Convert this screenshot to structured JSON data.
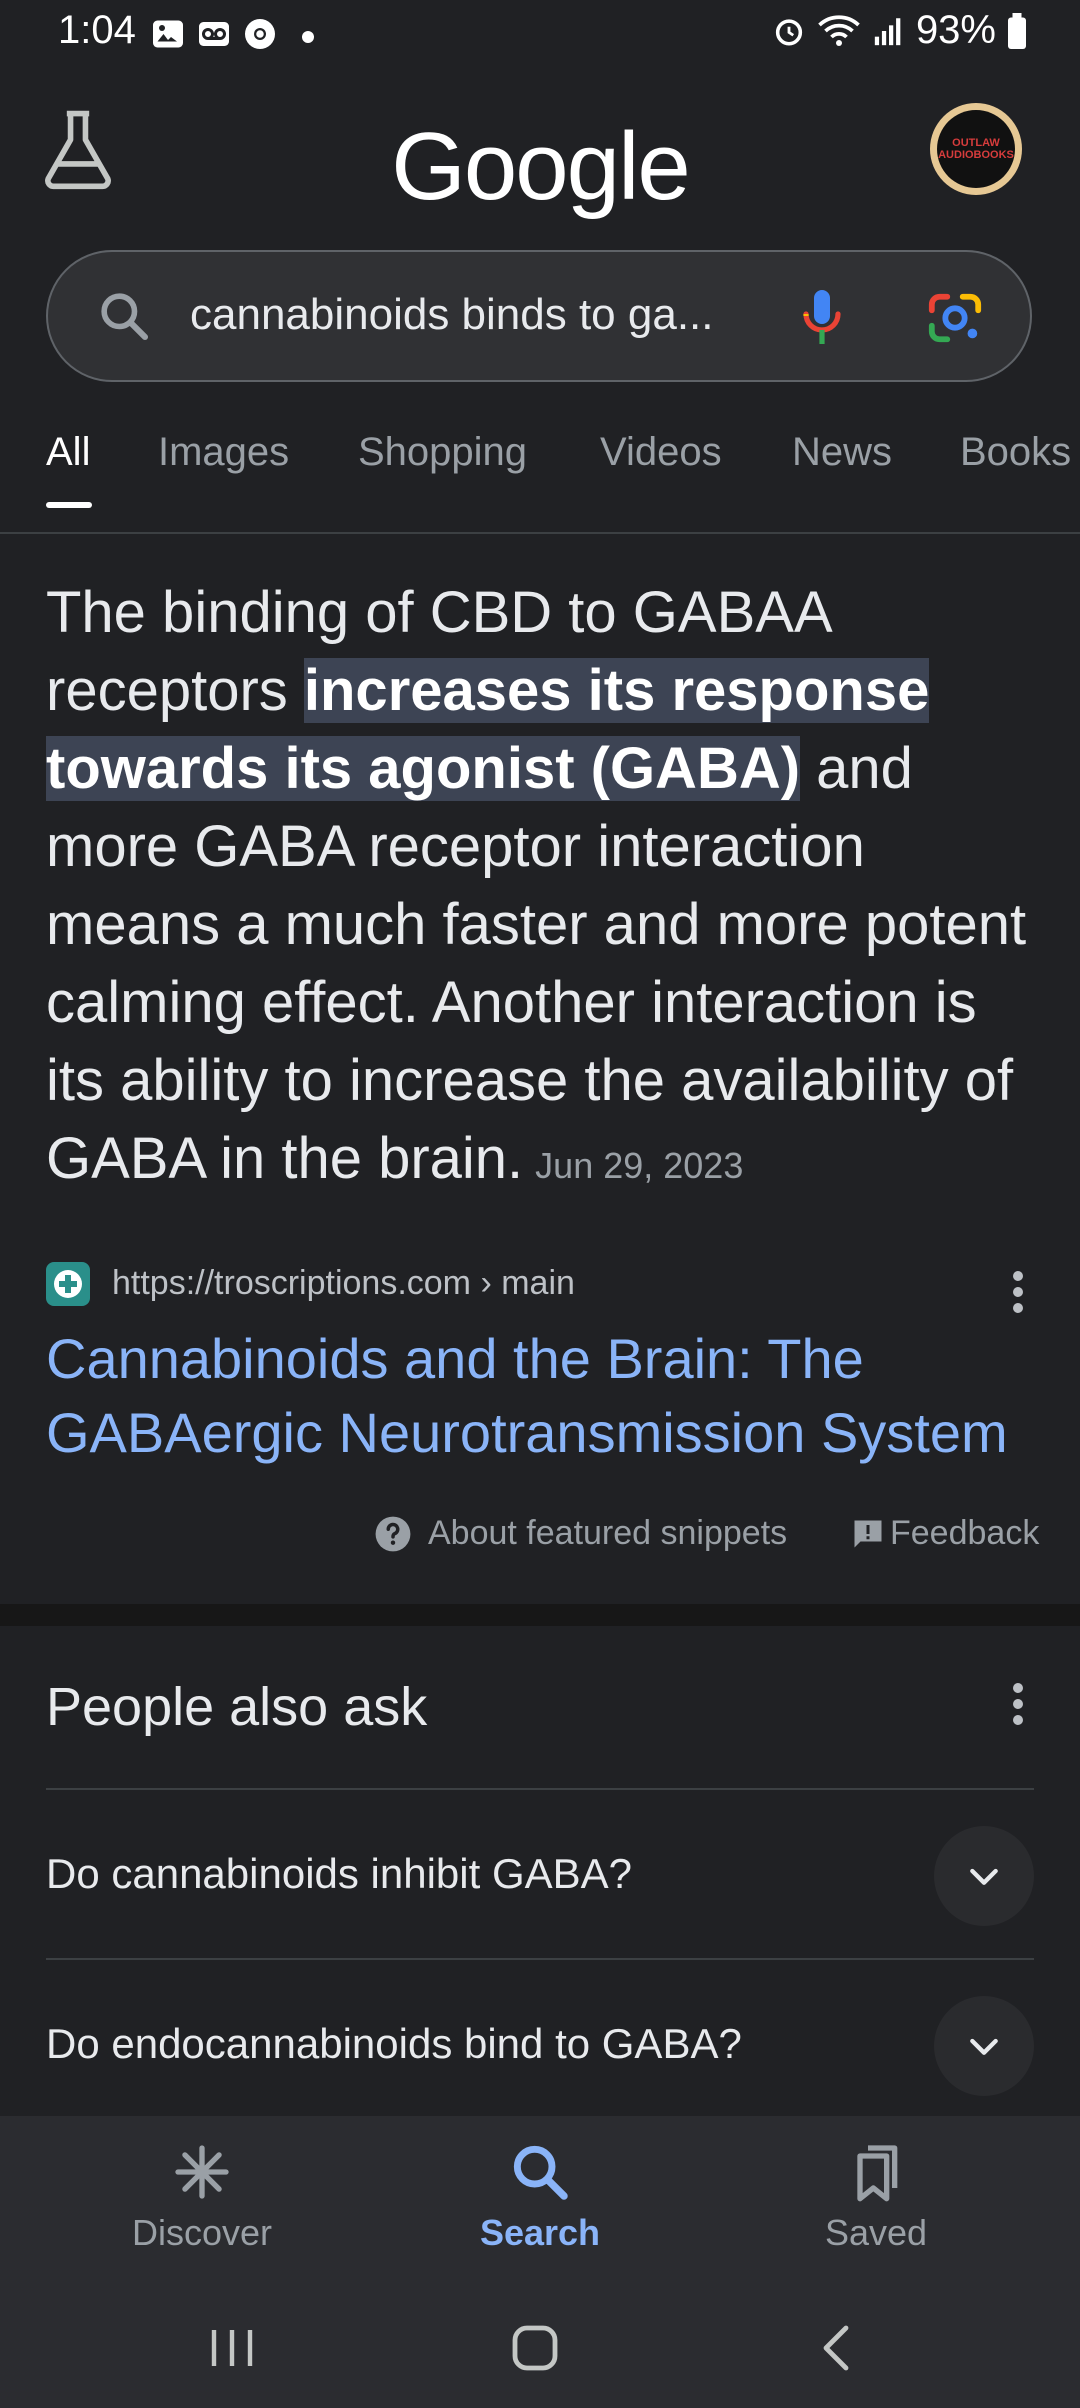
{
  "status_bar": {
    "time": "1:04",
    "battery": "93%"
  },
  "header": {
    "logo": "Google",
    "avatar_text": "OUTLAW AUDIOBOOKS"
  },
  "search": {
    "query": "cannabinoids binds to ga..."
  },
  "tabs": [
    {
      "label": "All",
      "active": true
    },
    {
      "label": "Images"
    },
    {
      "label": "Shopping"
    },
    {
      "label": "Videos"
    },
    {
      "label": "News"
    },
    {
      "label": "Books"
    }
  ],
  "snippet": {
    "text_before": "The binding of CBD to GABAA receptors ",
    "highlight": "increases its response towards its agonist (GABA)",
    "text_after": " and more GABA receptor interaction means a much faster and more potent calming effect. Another interaction is its ability to increase the availability of GABA in the brain.",
    "date": "Jun 29, 2023"
  },
  "source": {
    "url": "https://troscriptions.com › main",
    "title": "Cannabinoids and the Brain: The GABAergic Neurotransmission System"
  },
  "snippet_footer": {
    "about": "About featured snippets",
    "feedback": "Feedback"
  },
  "people_also_ask": {
    "title": "People also ask",
    "questions": [
      "Do cannabinoids inhibit GABA?",
      "Do endocannabinoids bind to GABA?"
    ]
  },
  "bottom_nav": [
    {
      "label": "Discover",
      "icon": "asterisk-icon"
    },
    {
      "label": "Search",
      "icon": "search-icon",
      "active": true
    },
    {
      "label": "Saved",
      "icon": "bookmark-icon"
    }
  ],
  "colors": {
    "background": "#202124",
    "link": "#8ab4f8",
    "highlight_bg": "#3d4454"
  }
}
